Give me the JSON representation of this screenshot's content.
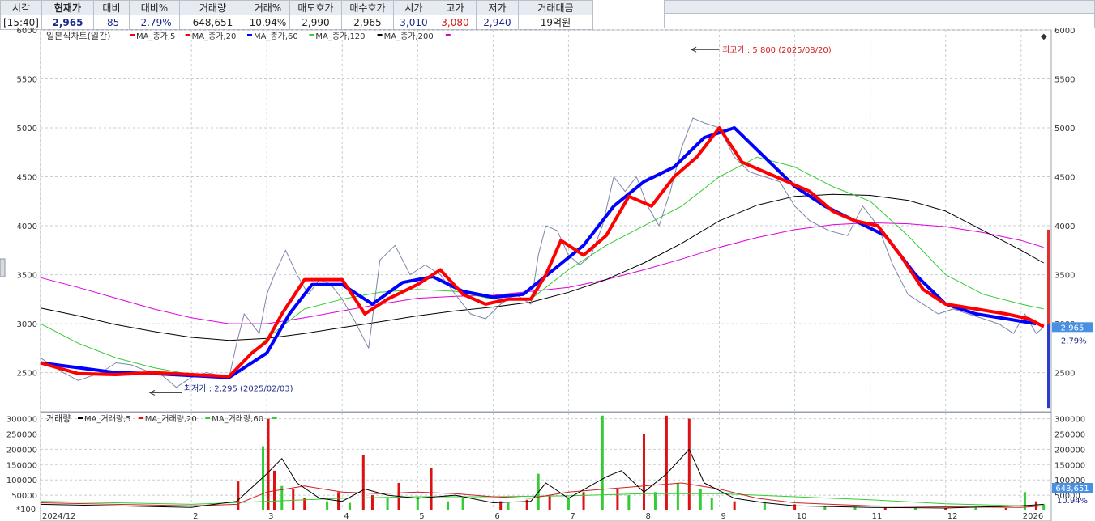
{
  "quote": {
    "headers": [
      "시각",
      "현재가",
      "대비",
      "대비%",
      "거래량",
      "거래%",
      "매도호가",
      "매수호가",
      "시가",
      "고가",
      "저가",
      "거래대금"
    ],
    "values": [
      "[15:40]",
      "2,965",
      "-85",
      "-2.79%",
      "648,651",
      "10.94%",
      "2,990",
      "2,965",
      "3,010",
      "3,080",
      "2,940",
      "19억원"
    ]
  },
  "chart_data": [
    {
      "type": "line",
      "title": "일본식차트(일간)",
      "legend": [
        {
          "name": "MA_종가,5",
          "color": "#ff0000"
        },
        {
          "name": "MA_종가,20",
          "color": "#ff0000"
        },
        {
          "name": "MA_종가,60",
          "color": "#0000ff"
        },
        {
          "name": "MA_종가,120",
          "color": "#33cc33"
        },
        {
          "name": "MA_종가,200",
          "color": "#000000"
        },
        {
          "name": "",
          "color": "#dd00dd"
        }
      ],
      "y_ticks": [
        6000,
        5500,
        5000,
        4500,
        4000,
        3500,
        3000,
        2500
      ],
      "ylim": [
        2100,
        6000
      ],
      "x_ticks": [
        "2024/12",
        "2",
        "3",
        "4",
        "5",
        "6",
        "7",
        "8",
        "9",
        "10",
        "11",
        "12",
        "2026"
      ],
      "x_tick_months": [
        0,
        2,
        3,
        4,
        5,
        6,
        7,
        8,
        9,
        10,
        11,
        12,
        13
      ],
      "xlim": [
        0,
        13.4
      ],
      "annotations": {
        "high": {
          "label": "최고가 : 5,800 (2025/08/20)",
          "month": 8.63,
          "value": 5800
        },
        "low": {
          "label": "최저가 : 2,295 (2025/02/03)",
          "month": 1.45,
          "value": 2295
        }
      },
      "current_price_label": "2,965",
      "current_change_label": "-2.79%",
      "current_price": 2965,
      "close": {
        "month": [
          0,
          0.3,
          0.5,
          0.8,
          1.0,
          1.2,
          1.4,
          1.6,
          1.8,
          2.0,
          2.2,
          2.5,
          2.6,
          2.7,
          2.8,
          2.9,
          3.0,
          3.1,
          3.25,
          3.4,
          3.55,
          3.7,
          3.85,
          4.0,
          4.15,
          4.25,
          4.35,
          4.5,
          4.7,
          4.9,
          5.1,
          5.3,
          5.5,
          5.7,
          5.9,
          6.1,
          6.3,
          6.5,
          6.6,
          6.7,
          6.85,
          7.0,
          7.15,
          7.3,
          7.45,
          7.6,
          7.75,
          7.9,
          8.05,
          8.2,
          8.35,
          8.5,
          8.65,
          8.8,
          9.0,
          9.2,
          9.4,
          9.6,
          9.8,
          10.0,
          10.2,
          10.45,
          10.7,
          10.9,
          11.1,
          11.3,
          11.5,
          11.7,
          11.9,
          12.1,
          12.3,
          12.5,
          12.7,
          12.9,
          13.05,
          13.2,
          13.3
        ],
        "value": [
          2650,
          2500,
          2420,
          2500,
          2600,
          2580,
          2520,
          2480,
          2350,
          2450,
          2500,
          2450,
          2800,
          3100,
          3000,
          2900,
          3300,
          3500,
          3750,
          3500,
          3300,
          3450,
          3400,
          3250,
          3050,
          2900,
          2750,
          3650,
          3800,
          3500,
          3600,
          3500,
          3300,
          3100,
          3050,
          3200,
          3300,
          3200,
          3700,
          4000,
          3950,
          3700,
          3600,
          3700,
          4000,
          4500,
          4350,
          4500,
          4200,
          4000,
          4350,
          4800,
          5100,
          5050,
          5000,
          4700,
          4550,
          4500,
          4450,
          4200,
          4050,
          3950,
          3900,
          4200,
          4000,
          3600,
          3300,
          3200,
          3100,
          3150,
          3100,
          3050,
          3000,
          2900,
          3100,
          2900,
          2965
        ]
      },
      "ma20": {
        "month": [
          0,
          0.5,
          1.0,
          1.5,
          2.0,
          2.5,
          2.8,
          3.0,
          3.2,
          3.5,
          3.8,
          4.0,
          4.3,
          4.6,
          5.0,
          5.3,
          5.6,
          5.9,
          6.2,
          6.5,
          6.7,
          6.9,
          7.2,
          7.5,
          7.8,
          8.1,
          8.4,
          8.7,
          9.0,
          9.3,
          9.6,
          9.9,
          10.2,
          10.5,
          10.8,
          11.1,
          11.4,
          11.7,
          12.0,
          12.4,
          12.8,
          13.1,
          13.3
        ],
        "value": [
          2600,
          2490,
          2480,
          2500,
          2480,
          2460,
          2700,
          2820,
          3100,
          3450,
          3450,
          3450,
          3100,
          3250,
          3400,
          3550,
          3300,
          3200,
          3250,
          3250,
          3500,
          3850,
          3700,
          3900,
          4300,
          4200,
          4500,
          4700,
          5000,
          4650,
          4550,
          4450,
          4350,
          4150,
          4050,
          4000,
          3700,
          3350,
          3200,
          3150,
          3100,
          3050,
          2970
        ]
      },
      "ma60": {
        "month": [
          0,
          0.5,
          1.0,
          1.5,
          2.0,
          2.5,
          3.0,
          3.3,
          3.6,
          4.0,
          4.4,
          4.8,
          5.2,
          5.6,
          6.0,
          6.4,
          6.8,
          7.2,
          7.6,
          8.0,
          8.4,
          8.8,
          9.2,
          9.6,
          10.0,
          10.4,
          10.8,
          11.2,
          11.6,
          12.0,
          12.4,
          12.8,
          13.2
        ],
        "value": [
          2600,
          2550,
          2500,
          2490,
          2470,
          2450,
          2700,
          3100,
          3400,
          3400,
          3200,
          3420,
          3480,
          3330,
          3270,
          3300,
          3550,
          3800,
          4200,
          4450,
          4600,
          4900,
          5000,
          4700,
          4400,
          4200,
          4050,
          3900,
          3500,
          3200,
          3100,
          3050,
          3000
        ]
      },
      "ma120": {
        "month": [
          0,
          0.5,
          1.0,
          1.5,
          2.0,
          2.5,
          3.0,
          3.5,
          4.0,
          4.5,
          5.0,
          5.5,
          6.0,
          6.5,
          7.0,
          7.5,
          8.0,
          8.5,
          9.0,
          9.5,
          10.0,
          10.5,
          11.0,
          11.5,
          12.0,
          12.5,
          13.0,
          13.3
        ],
        "value": [
          3000,
          2800,
          2650,
          2550,
          2480,
          2450,
          2850,
          3150,
          3250,
          3320,
          3350,
          3330,
          3250,
          3250,
          3550,
          3800,
          4000,
          4200,
          4500,
          4700,
          4600,
          4400,
          4250,
          3900,
          3500,
          3300,
          3200,
          3150
        ]
      },
      "ma200": {
        "month": [
          0,
          0.5,
          1.0,
          1.5,
          2.0,
          2.5,
          3.0,
          3.5,
          4.0,
          4.5,
          5.0,
          5.5,
          6.0,
          6.5,
          7.0,
          7.5,
          8.0,
          8.5,
          9.0,
          9.5,
          10.0,
          10.5,
          11.0,
          11.5,
          12.0,
          12.5,
          13.0,
          13.3
        ],
        "value": [
          3160,
          3080,
          2990,
          2920,
          2860,
          2830,
          2850,
          2900,
          2960,
          3020,
          3080,
          3130,
          3170,
          3220,
          3320,
          3450,
          3620,
          3820,
          4050,
          4210,
          4300,
          4320,
          4310,
          4260,
          4150,
          3950,
          3750,
          3620
        ]
      },
      "ma_magenta": {
        "month": [
          0,
          0.5,
          1.0,
          1.5,
          2.0,
          2.5,
          3.0,
          3.5,
          4.0,
          4.5,
          5.0,
          5.5,
          6.0,
          6.5,
          7.0,
          7.5,
          8.0,
          8.5,
          9.0,
          9.5,
          10.0,
          10.5,
          11.0,
          11.5,
          12.0,
          12.5,
          13.0,
          13.3
        ],
        "value": [
          3470,
          3370,
          3260,
          3150,
          3060,
          3000,
          3000,
          3060,
          3130,
          3200,
          3260,
          3280,
          3290,
          3330,
          3370,
          3450,
          3550,
          3660,
          3780,
          3880,
          3960,
          4010,
          4030,
          4020,
          3990,
          3930,
          3850,
          3780
        ]
      }
    },
    {
      "type": "bar",
      "title": "거래량",
      "legend": [
        {
          "name": "MA_거래량,5",
          "color": "#000000"
        },
        {
          "name": "MA_거래량,20",
          "color": "#ff0000"
        },
        {
          "name": "MA_거래량,60",
          "color": "#33cc33"
        }
      ],
      "y_ticks": [
        300000,
        250000,
        200000,
        150000,
        100000,
        50000
      ],
      "ylim": [
        0,
        320000
      ],
      "unit_label": "*100",
      "current_volume_label": "648,651",
      "current_ratio_label": "10.94%",
      "bars": {
        "month": [
          2.62,
          2.95,
          3.02,
          3.1,
          3.2,
          3.35,
          3.5,
          3.8,
          3.95,
          4.1,
          4.28,
          4.4,
          4.6,
          4.75,
          5.0,
          5.18,
          5.4,
          5.6,
          6.1,
          6.2,
          6.45,
          6.6,
          6.75,
          7.0,
          7.2,
          7.45,
          7.65,
          7.8,
          8.0,
          8.15,
          8.3,
          8.45,
          8.6,
          8.75,
          8.9,
          9.2,
          9.6,
          10.0,
          10.4,
          10.8,
          11.2,
          11.6,
          12.0,
          12.4,
          12.8,
          13.05,
          13.2,
          13.3
        ],
        "value": [
          95000,
          210000,
          300000,
          130000,
          80000,
          70000,
          40000,
          30000,
          60000,
          25000,
          180000,
          50000,
          40000,
          90000,
          45000,
          140000,
          30000,
          40000,
          30000,
          25000,
          35000,
          120000,
          50000,
          40000,
          60000,
          310000,
          70000,
          50000,
          250000,
          60000,
          310000,
          90000,
          300000,
          70000,
          40000,
          30000,
          25000,
          20000,
          15000,
          12000,
          10000,
          10000,
          9000,
          9000,
          8000,
          60000,
          30000,
          20000
        ],
        "up": [
          true,
          false,
          true,
          true,
          false,
          true,
          true,
          false,
          true,
          false,
          true,
          true,
          false,
          true,
          false,
          true,
          false,
          false,
          true,
          false,
          true,
          false,
          true,
          false,
          true,
          false,
          true,
          false,
          true,
          false,
          true,
          false,
          true,
          false,
          false,
          true,
          false,
          true,
          false,
          false,
          true,
          false,
          true,
          false,
          true,
          false,
          true,
          false
        ]
      },
      "ma5": {
        "month": [
          0,
          1,
          2,
          2.6,
          3.0,
          3.2,
          3.4,
          3.7,
          4.0,
          4.3,
          4.6,
          5.0,
          5.5,
          6.0,
          6.5,
          6.7,
          7.0,
          7.5,
          7.7,
          8.0,
          8.3,
          8.6,
          8.8,
          9.2,
          9.6,
          10.0,
          11.0,
          12.0,
          13.0,
          13.3
        ],
        "value": [
          20000,
          15000,
          10000,
          30000,
          120000,
          170000,
          90000,
          40000,
          30000,
          70000,
          50000,
          40000,
          50000,
          25000,
          30000,
          90000,
          40000,
          110000,
          130000,
          60000,
          120000,
          200000,
          90000,
          40000,
          25000,
          15000,
          10000,
          8000,
          15000,
          20000
        ]
      },
      "ma20": {
        "month": [
          0,
          1,
          2,
          2.6,
          3.0,
          3.5,
          4.0,
          4.5,
          5.0,
          5.5,
          6.0,
          6.5,
          7.0,
          7.5,
          8.0,
          8.5,
          9.0,
          9.5,
          10.0,
          11.0,
          12.0,
          13.0,
          13.3
        ],
        "value": [
          25000,
          20000,
          15000,
          20000,
          60000,
          80000,
          60000,
          55000,
          60000,
          55000,
          45000,
          40000,
          60000,
          70000,
          80000,
          90000,
          70000,
          40000,
          25000,
          15000,
          12000,
          10000,
          15000
        ]
      },
      "ma60": {
        "month": [
          0,
          1,
          2,
          3,
          4,
          5,
          6,
          7,
          8,
          9,
          10,
          11,
          12,
          13,
          13.3
        ],
        "value": [
          30000,
          25000,
          20000,
          30000,
          40000,
          45000,
          45000,
          48000,
          55000,
          55000,
          45000,
          35000,
          22000,
          15000,
          15000
        ]
      }
    }
  ]
}
